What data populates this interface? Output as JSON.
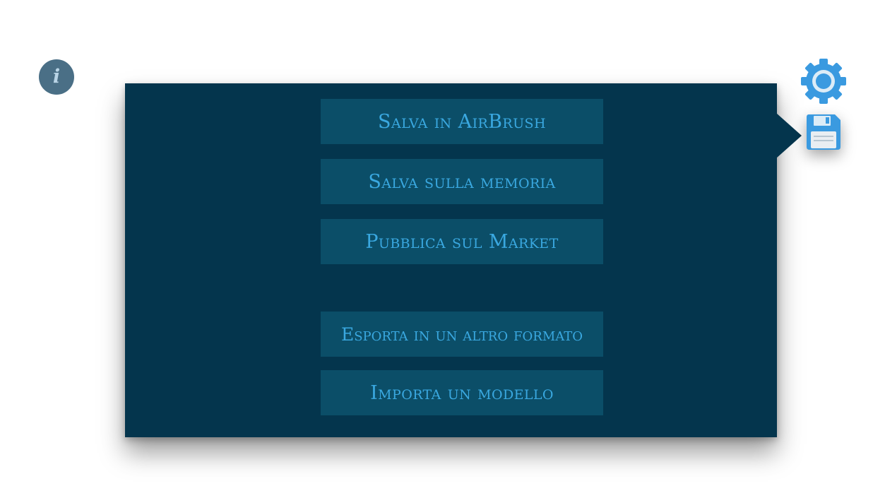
{
  "info": {
    "glyph": "i"
  },
  "menu": {
    "items": [
      {
        "label": "Salva in AirBrush"
      },
      {
        "label": "Salva sulla memoria"
      },
      {
        "label": "Pubblica sul Market"
      },
      {
        "label": "Esporta in un altro formato"
      },
      {
        "label": "Importa un modello"
      }
    ]
  },
  "toolbar": {
    "settings_icon": "gear-icon",
    "save_icon": "floppy-disk-icon"
  },
  "colors": {
    "panel": "#04354d",
    "button": "#0b4e68",
    "button_text": "#3aa8e0",
    "info_button": "#4a6f86",
    "accent_icon": "#3a9ae0"
  }
}
